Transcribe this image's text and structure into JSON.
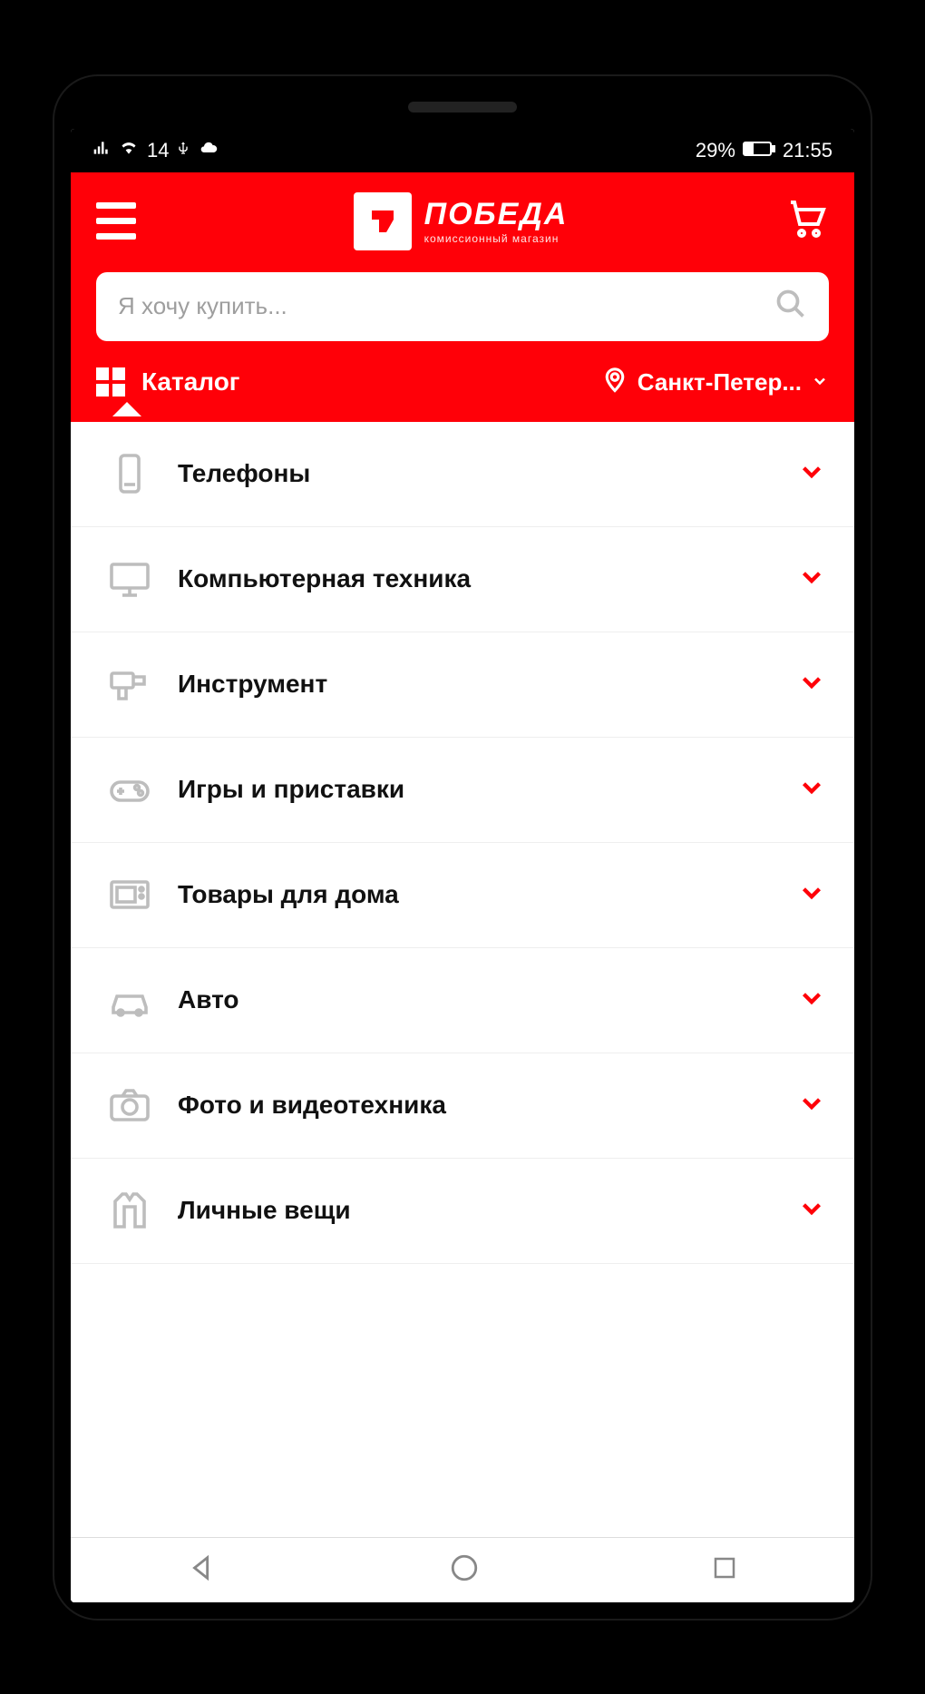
{
  "status_bar": {
    "signal": "14",
    "battery_text": "29%",
    "time": "21:55"
  },
  "header": {
    "logo_title": "ПОБЕДА",
    "logo_subtitle": "комиссионный магазин"
  },
  "search": {
    "placeholder": "Я хочу купить..."
  },
  "tabbar": {
    "catalog_label": "Каталог",
    "location_label": "Санкт-Петер..."
  },
  "categories": [
    {
      "icon": "phone",
      "label": "Телефоны"
    },
    {
      "icon": "monitor",
      "label": "Компьютерная техника"
    },
    {
      "icon": "drill",
      "label": "Инструмент"
    },
    {
      "icon": "gamepad",
      "label": "Игры и приставки"
    },
    {
      "icon": "microwave",
      "label": "Товары для дома"
    },
    {
      "icon": "car",
      "label": "Авто"
    },
    {
      "icon": "camera",
      "label": "Фото и видеотехника"
    },
    {
      "icon": "jacket",
      "label": "Личные вещи"
    }
  ]
}
